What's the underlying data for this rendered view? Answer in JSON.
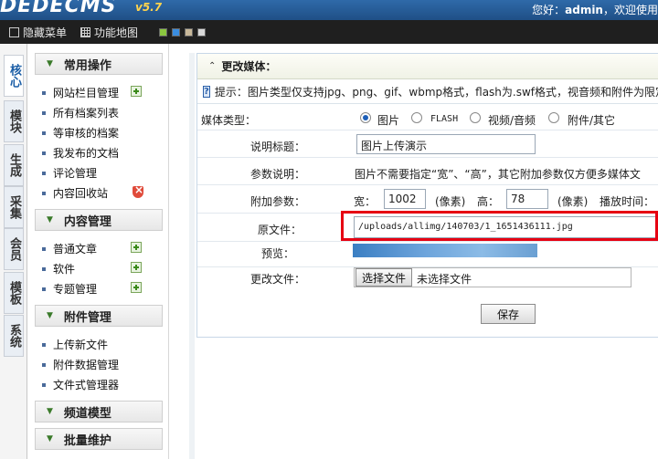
{
  "header": {
    "logo_text": "DEDECMS",
    "version": "v5.7",
    "greeting_prefix": "您好：",
    "username": "admin",
    "greeting_suffix": "，欢迎使用"
  },
  "toolbar": {
    "hide_menu_label": "隐藏菜单",
    "function_map_label": "功能地图",
    "skin_colors": [
      "#8bc63f",
      "#3a8de0",
      "#c8b89a",
      "#d9d9d9"
    ]
  },
  "left_tabs": [
    {
      "label": "核心"
    },
    {
      "label": "模块"
    },
    {
      "label": "生成"
    },
    {
      "label": "采集"
    },
    {
      "label": "会员"
    },
    {
      "label": "模板"
    },
    {
      "label": "系统"
    }
  ],
  "sidebar": {
    "sections": [
      {
        "title": "常用操作",
        "items": [
          "网站栏目管理",
          "所有档案列表",
          "等审核的档案",
          "我发布的文档",
          "评论管理",
          "内容回收站"
        ]
      },
      {
        "title": "内容管理",
        "items": [
          "普通文章",
          "软件",
          "专题管理"
        ]
      },
      {
        "title": "附件管理",
        "items": [
          "上传新文件",
          "附件数据管理",
          "文件式管理器"
        ]
      },
      {
        "title": "频道模型",
        "items": []
      },
      {
        "title": "批量维护",
        "items": []
      }
    ]
  },
  "form": {
    "title": "更改媒体：",
    "tip": "提示：图片类型仅支持jpg、png、gif、wbmp格式，flash为.swf格式，视音频和附件为限定",
    "media_type_label": "媒体类型：",
    "media_options": [
      "图片",
      "FLASH",
      "视频/音频",
      "附件/其它"
    ],
    "media_selected": "图片",
    "desc_title_label": "说明标题：",
    "desc_title_value": "图片上传演示",
    "param_desc_label": "参数说明：",
    "param_desc_text": "图片不需要指定“宽”、“高”，其它附加参数仅方便多媒体文",
    "extra_param_label": "附加参数：",
    "width_label": "宽：",
    "width_value": "1002",
    "width_unit": "(像素)",
    "height_label": "高：",
    "height_value": "78",
    "height_unit": "(像素)",
    "play_time_label": "播放时间：",
    "original_file_label": "原文件：",
    "original_file_value": "/uploads/allimg/140703/1_1651436111.jpg",
    "preview_label": "预览：",
    "change_file_label": "更改文件：",
    "choose_file_button": "选择文件",
    "no_file_text": "未选择文件",
    "save_button": "保存"
  }
}
